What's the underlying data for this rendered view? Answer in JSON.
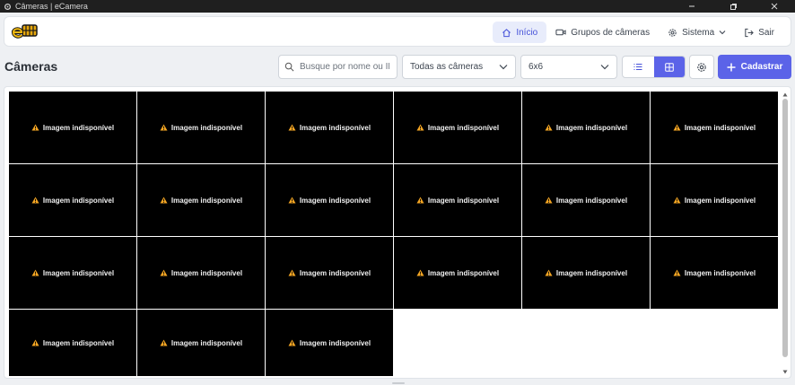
{
  "window": {
    "title": "Câmeras | eCamera"
  },
  "nav": {
    "home_label": "Início",
    "groups_label": "Grupos de câmeras",
    "system_label": "Sistema",
    "logout_label": "Sair"
  },
  "page": {
    "title": "Câmeras"
  },
  "toolbar": {
    "search_placeholder": "Busque por nome ou ID",
    "search_value": "",
    "group_filter": "Todas as câmeras",
    "grid_layout": "6x6",
    "add_label": "Cadastrar",
    "view_mode": "grid"
  },
  "cameras": {
    "unavailable_text": "Imagem indisponível",
    "count": 21
  },
  "colors": {
    "accent": "#5b63e8",
    "active_nav_bg": "#e8ecfb",
    "warning": "#f5a623",
    "tile_bg": "#000000"
  }
}
